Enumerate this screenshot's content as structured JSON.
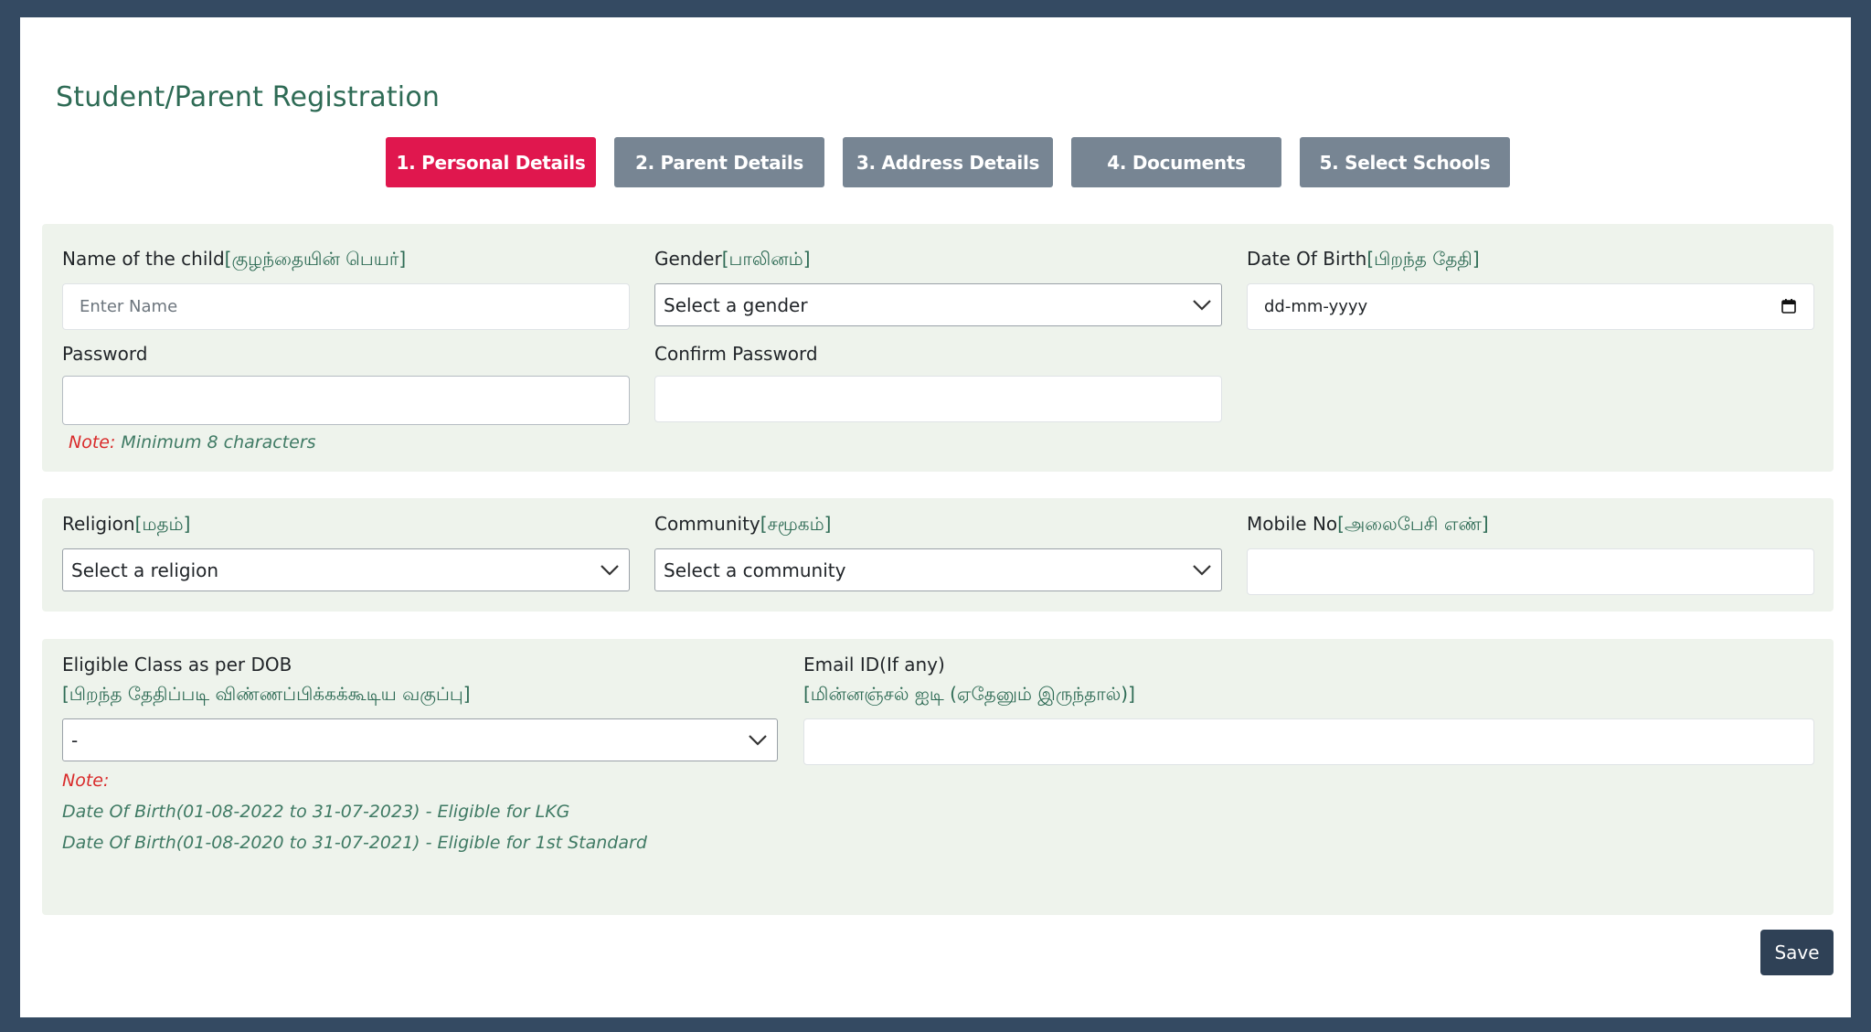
{
  "page_title": "Student/Parent Registration",
  "tabs": [
    {
      "label": "1. Personal Details"
    },
    {
      "label": "2. Parent Details"
    },
    {
      "label": "3. Address Details"
    },
    {
      "label": "4. Documents"
    },
    {
      "label": "5. Select Schools"
    }
  ],
  "active_tab": "1. Personal Details",
  "fields": {
    "child_name": {
      "label": "Name of the child",
      "tamil": "[குழந்தையின் பெயர்]",
      "placeholder": "Enter Name",
      "value": ""
    },
    "gender": {
      "label": "Gender",
      "tamil": "[பாலினம்]",
      "selected": "Select a gender"
    },
    "dob": {
      "label": "Date Of Birth",
      "tamil": "[பிறந்த தேதி]",
      "value": "dd-mm-yyyy"
    },
    "password": {
      "label": "Password",
      "value": "",
      "note_prefix": "Note:",
      "note_text": " Minimum 8 characters"
    },
    "confirm_password": {
      "label": "Confirm Password",
      "value": ""
    },
    "religion": {
      "label": "Religion",
      "tamil": "[மதம்]",
      "selected": "Select a religion"
    },
    "community": {
      "label": "Community",
      "tamil": "[சமூகம்]",
      "selected": "Select a community"
    },
    "mobile": {
      "label": "Mobile No",
      "tamil": "[அலைபேசி எண்]",
      "value": ""
    },
    "eligible_class": {
      "label": "Eligible Class as per DOB",
      "tamil": "[பிறந்த தேதிப்படி விண்ணப்பிக்கக்கூடிய வகுப்பு]",
      "selected": "-",
      "note_prefix": "Note:",
      "notes": [
        "Date Of Birth(01-08-2022 to 31-07-2023) - Eligible for LKG",
        "Date Of Birth(01-08-2020 to 31-07-2021) - Eligible for 1st Standard"
      ]
    },
    "email": {
      "label": "Email ID(If any)",
      "tamil": "[மின்னஞ்சல் ஐடி (ஏதேனும் இருந்தால்)]",
      "value": ""
    }
  },
  "save_label": "Save",
  "colors": {
    "accent": "#e0174e",
    "tab_inactive": "#778593",
    "title": "#2e6b55",
    "panel_bg": "#eef3ec",
    "note_red": "#d92b2b",
    "save_bg": "#2f4156",
    "page_bg": "#344a62"
  },
  "icons": {
    "select_arrow": "chevron-down-icon",
    "date_picker": "calendar-icon"
  }
}
